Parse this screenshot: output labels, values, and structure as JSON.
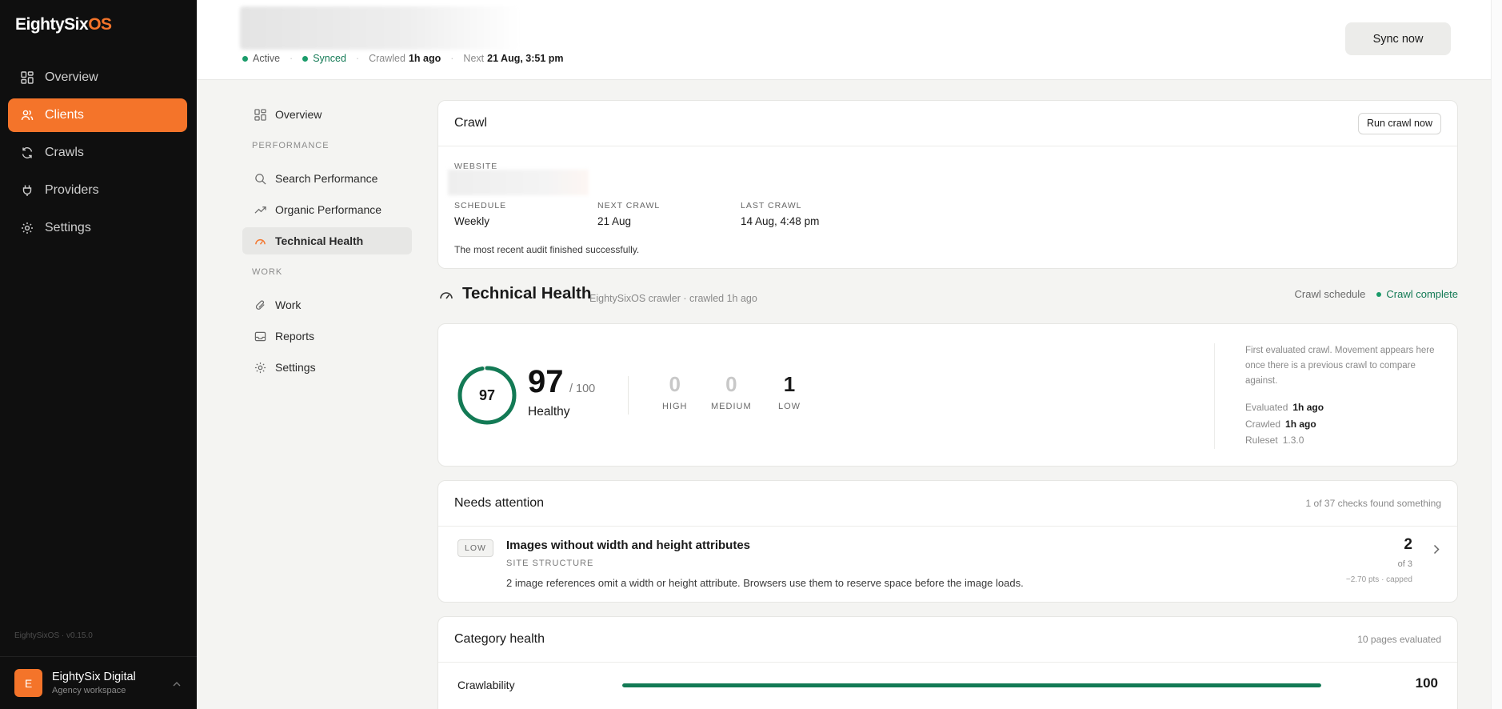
{
  "app": {
    "logo_main": "EightySix",
    "logo_accent": "OS",
    "version": "EightySixOS · v0.15.0"
  },
  "sidebar": {
    "items": [
      {
        "label": "Overview",
        "icon": "grid-icon",
        "active": false
      },
      {
        "label": "Clients",
        "icon": "users-icon",
        "active": true
      },
      {
        "label": "Crawls",
        "icon": "refresh-icon",
        "active": false
      },
      {
        "label": "Providers",
        "icon": "plug-icon",
        "active": false
      },
      {
        "label": "Settings",
        "icon": "gear-icon",
        "active": false
      }
    ],
    "workspace": {
      "initial": "E",
      "name": "EightySix Digital",
      "sub": "Agency workspace"
    }
  },
  "header": {
    "status_active": "Active",
    "status_synced": "Synced",
    "crawled_label": "Crawled",
    "crawled_value": "1h ago",
    "next_label": "Next",
    "next_value": "21 Aug, 3:51 pm",
    "sync_button": "Sync now"
  },
  "subnav": {
    "overview": "Overview",
    "performance_section": "PERFORMANCE",
    "search_performance": "Search Performance",
    "organic_performance": "Organic Performance",
    "technical_health": "Technical Health",
    "work_section": "WORK",
    "work": "Work",
    "reports": "Reports",
    "settings": "Settings"
  },
  "crawl": {
    "title": "Crawl",
    "run_button": "Run crawl now",
    "website_label": "WEBSITE",
    "schedule_label": "SCHEDULE",
    "schedule_value": "Weekly",
    "next_label": "NEXT CRAWL",
    "next_value": "21 Aug",
    "last_label": "LAST CRAWL",
    "last_value": "14 Aug, 4:48 pm",
    "message": "The most recent audit finished successfully."
  },
  "technical_health": {
    "title": "Technical Health",
    "subtitle": "EightySixOS crawler · crawled 1h ago",
    "schedule_link": "Crawl schedule",
    "status": "Crawl complete",
    "score": "97",
    "score_fraction": 0.97,
    "out_of": "/ 100",
    "rating": "Healthy",
    "high_count": "0",
    "high_label": "HIGH",
    "medium_count": "0",
    "medium_label": "MEDIUM",
    "low_count": "1",
    "low_label": "LOW",
    "note": "First evaluated crawl. Movement appears here once there is a previous crawl to compare against.",
    "evaluated_label": "Evaluated",
    "evaluated_value": "1h ago",
    "crawled_label": "Crawled",
    "crawled_value": "1h ago",
    "ruleset_label": "Ruleset",
    "ruleset_value": "1.3.0"
  },
  "needs_attention": {
    "title": "Needs attention",
    "summary": "1 of 37 checks found something",
    "issue": {
      "severity": "LOW",
      "title": "Images without width and height attributes",
      "category": "SITE STRUCTURE",
      "description": "2 image references omit a width or height attribute. Browsers use them to reserve space before the image loads.",
      "count": "2",
      "of": "of 3",
      "points": "−2.70 pts · capped"
    }
  },
  "category_health": {
    "title": "Category health",
    "summary": "10 pages evaluated",
    "rows": [
      {
        "name": "Crawlability",
        "value": "100",
        "fraction": 1.0
      }
    ]
  },
  "colors": {
    "accent": "#f4742a",
    "success": "#137a55",
    "sidebar_bg": "#0f0f0f"
  }
}
